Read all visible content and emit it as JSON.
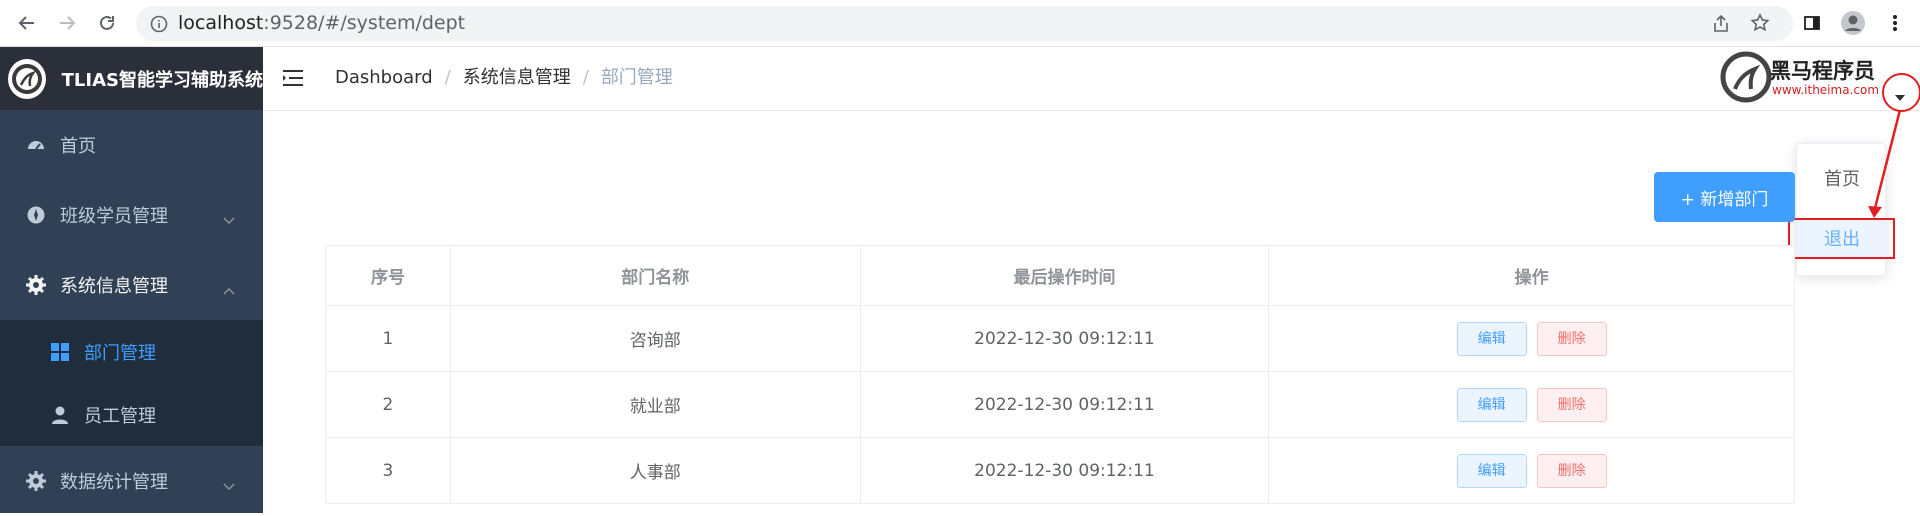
{
  "browser": {
    "url_host": "localhost",
    "url_rest": ":9528/#/system/dept"
  },
  "sidebar": {
    "title": "TLIAS智能学习辅助系统",
    "items": [
      {
        "label": "首页",
        "icon": "dashboard-icon"
      },
      {
        "label": "班级学员管理",
        "icon": "compass-icon"
      },
      {
        "label": "系统信息管理",
        "icon": "gear-icon"
      },
      {
        "label": "部门管理",
        "icon": "grid-icon"
      },
      {
        "label": "员工管理",
        "icon": "user-icon"
      },
      {
        "label": "数据统计管理",
        "icon": "gear-icon"
      }
    ]
  },
  "breadcrumb": [
    "Dashboard",
    "系统信息管理",
    "部门管理"
  ],
  "header_brand": {
    "name": "黑马程序员",
    "url": "www.itheima.com"
  },
  "dropdown": {
    "items": [
      "首页",
      "退出"
    ]
  },
  "toolbar": {
    "add_label": "+ 新增部门"
  },
  "table": {
    "headers": [
      "序号",
      "部门名称",
      "最后操作时间",
      "操作"
    ],
    "rows": [
      {
        "index": "1",
        "name": "咨询部",
        "time": "2022-12-30 09:12:11"
      },
      {
        "index": "2",
        "name": "就业部",
        "time": "2022-12-30 09:12:11"
      },
      {
        "index": "3",
        "name": "人事部",
        "time": "2022-12-30 09:12:11"
      }
    ],
    "edit_label": "编辑",
    "delete_label": "删除"
  },
  "colors": {
    "sidebar_bg": "#304156",
    "accent": "#409eff",
    "danger": "#f56c6c",
    "annotation": "#e02020"
  }
}
